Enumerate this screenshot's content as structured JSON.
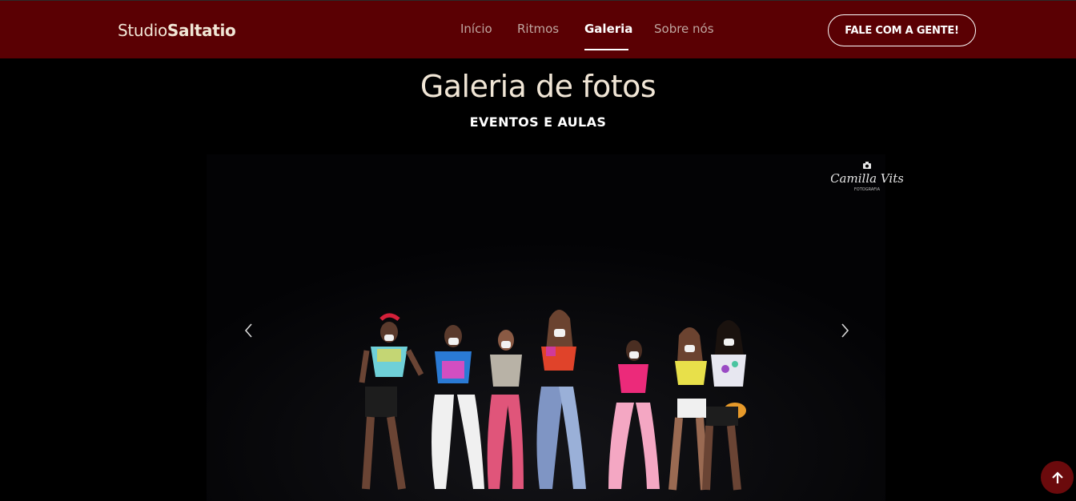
{
  "navbar": {
    "brand_light": "Studio",
    "brand_bold": "Saltatio",
    "links": [
      {
        "label": "Início",
        "active": false
      },
      {
        "label": "Ritmos",
        "active": false
      },
      {
        "label": "Galeria",
        "active": true
      },
      {
        "label": "Sobre nós",
        "active": false
      }
    ],
    "cta_label": "FALE COM A GENTE!"
  },
  "gallery": {
    "title": "Galeria de fotos",
    "subtitle": "EVENTOS E AULAS",
    "watermark_text": "Camilla Vits",
    "watermark_subtext": "FOTOGRAFIA"
  },
  "icons": {
    "prev": "chevron-left-icon",
    "next": "chevron-right-icon",
    "back_to_top": "arrow-up-icon",
    "camera": "camera-icon"
  },
  "colors": {
    "navbar_bg": "#5a0003",
    "brand_text": "#f1e6d6",
    "accent": "#6b0a0c"
  }
}
